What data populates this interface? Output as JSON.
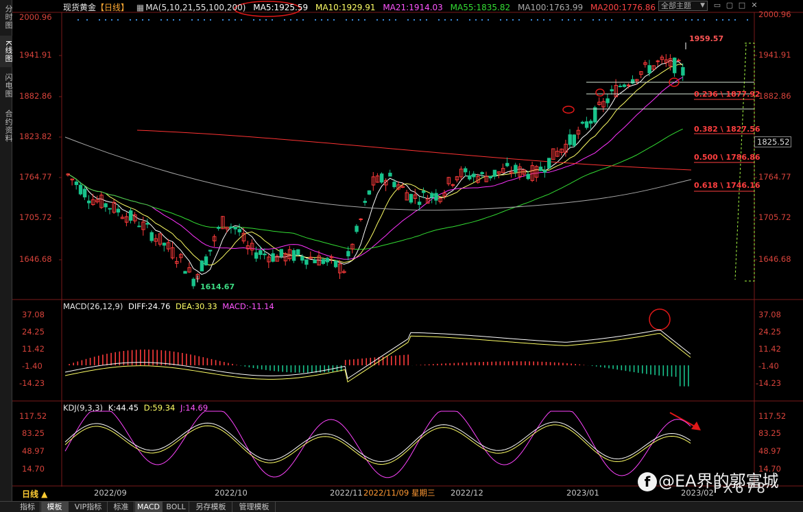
{
  "sidebar": {
    "tabs": [
      {
        "label": "分时图",
        "active": false
      },
      {
        "label": "K线图",
        "active": true
      },
      {
        "label": "闪电图",
        "active": false
      },
      {
        "label": "合约资料",
        "active": false
      }
    ]
  },
  "header": {
    "symbol": "现货黄金",
    "period_tag": "【日线】",
    "ma_label": "MA(5,10,21,55,100,200)",
    "ma5": "MA5:1925.59",
    "ma10": "MA10:1929.91",
    "ma21": "MA21:1914.03",
    "ma55": "MA55:1835.82",
    "ma100": "MA100:1763.99",
    "ma200": "MA200:1776.86",
    "theme_select": "全部主题",
    "theme_options": [
      "全部主题"
    ]
  },
  "price_axis": [
    "2000.96",
    "1941.91",
    "1882.86",
    "1823.82",
    "1764.77",
    "1705.72",
    "1646.68"
  ],
  "current_price": "1825.52",
  "annotations": {
    "high": "1959.57",
    "low": "1614.67"
  },
  "fib_levels": [
    {
      "label": "0.236 \\ 1877.92",
      "value": 1877.92
    },
    {
      "label": "0.382 \\ 1827.56",
      "value": 1827.56
    },
    {
      "label": "0.500 \\ 1786.86",
      "value": 1786.86
    },
    {
      "label": "0.618 \\ 1746.16",
      "value": 1746.16
    }
  ],
  "macd": {
    "label": "MACD(26,12,9)",
    "diff": "DIFF:24.76",
    "dea": "DEA:30.33",
    "macd": "MACD:-11.14",
    "axis": [
      "37.08",
      "24.25",
      "11.42",
      "-1.40",
      "-14.23"
    ]
  },
  "kdj": {
    "label": "KDJ(9,3,3)",
    "k": "K:44.45",
    "d": "D:59.34",
    "j": "J:14.69",
    "axis": [
      "117.52",
      "83.25",
      "48.97",
      "14.70"
    ]
  },
  "time_axis": [
    "2022/09",
    "2022/10",
    "2022/11",
    "2022/12",
    "2023/01",
    "2023/02"
  ],
  "cursor_date": "2022/11/09 星期三",
  "period_label": "日线 ▲",
  "bottom_tabs": [
    {
      "label": "指标",
      "active": false
    },
    {
      "label": "模板",
      "active": true
    },
    {
      "label": "VIP指标",
      "active": false
    },
    {
      "label": "标准",
      "active": false
    },
    {
      "label": "MACD",
      "active": true
    },
    {
      "label": "BOLL",
      "active": false
    },
    {
      "label": "另存模板",
      "active": false
    },
    {
      "label": "管理模板",
      "active": false
    }
  ],
  "watermark": "@EA界的郭富城",
  "watermark_icon": "f",
  "overlay_text": "PX678",
  "colors": {
    "up": "#ff3b3b",
    "down": "#18c38c",
    "axis": "#d8433b",
    "ma5": "#ffffff",
    "ma10": "#ffff66",
    "ma21": "#ff33ff",
    "ma55": "#33dd33",
    "ma100": "#aaaaaa",
    "ma200": "#ff3333"
  },
  "chart_data": {
    "type": "candlestick",
    "title": "现货黄金【日线】",
    "ylim": [
      1614.67,
      1959.57
    ],
    "price_low": 1614.67,
    "price_high": 1959.57,
    "time_range": [
      "2022/09",
      "2023/02"
    ],
    "horizontal_lines_price": [
      1900.5,
      1877.92,
      1864
    ],
    "fib_levels": [
      1877.92,
      1827.56,
      1786.86,
      1746.16
    ]
  }
}
